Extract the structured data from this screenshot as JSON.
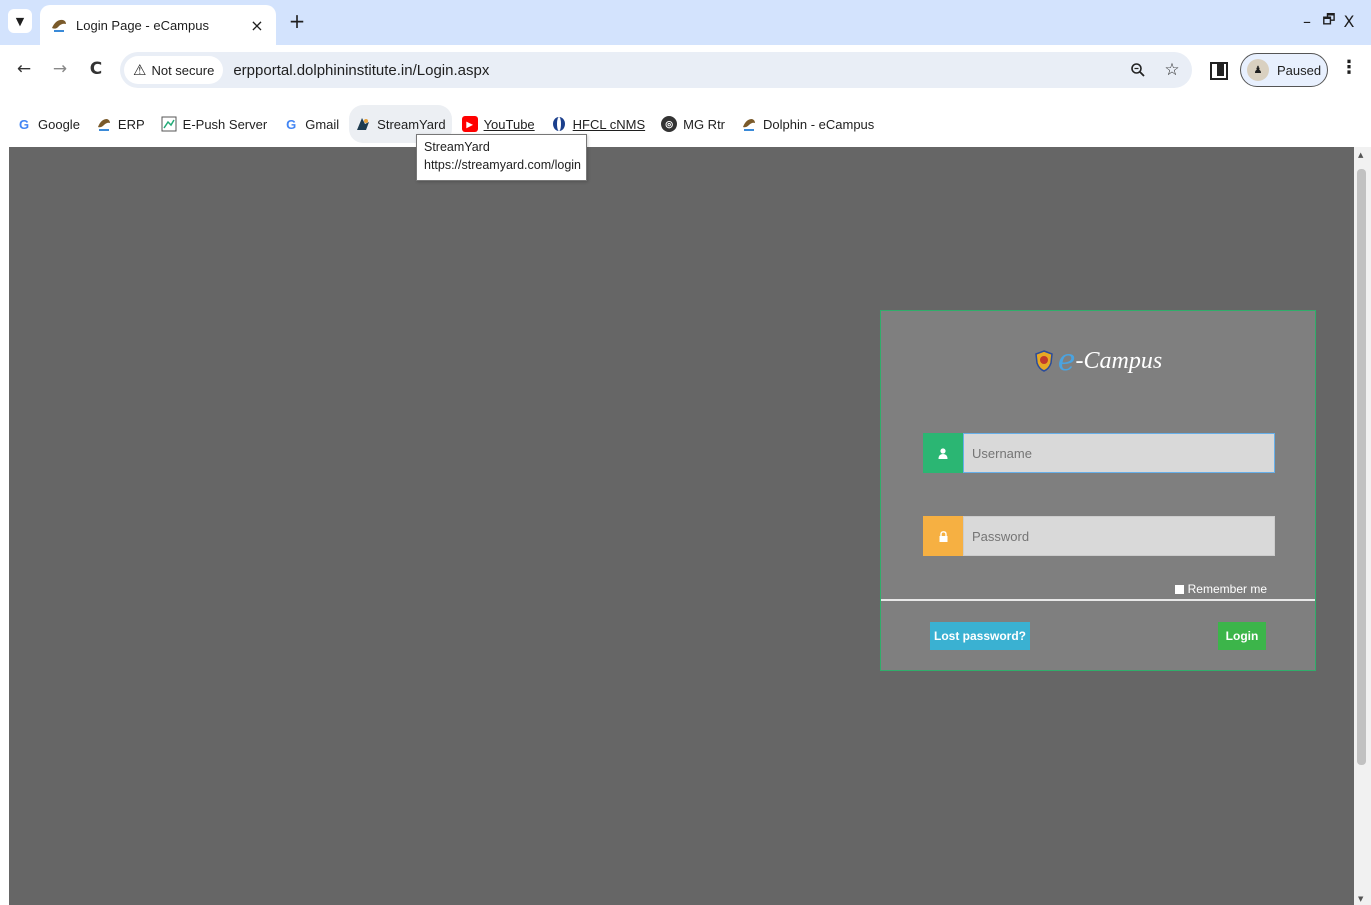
{
  "browser": {
    "tab": {
      "title": "Login Page - eCampus",
      "close": "×"
    },
    "new_tab": "+",
    "window_controls": {
      "minimize": "–",
      "restore": "🗗",
      "close": "X"
    },
    "nav": {
      "back": "←",
      "forward": "→",
      "reload": "C"
    },
    "security_label": "Not secure",
    "url": "erpportal.dolphininstitute.in/Login.aspx",
    "profile": {
      "status": "Paused"
    },
    "bookmarks": [
      {
        "label": "Google",
        "icon": "google-icon"
      },
      {
        "label": "ERP",
        "icon": "erp-icon"
      },
      {
        "label": "E-Push Server",
        "icon": "epush-icon"
      },
      {
        "label": "Gmail",
        "icon": "google-icon"
      },
      {
        "label": "StreamYard",
        "icon": "streamyard-icon"
      },
      {
        "label": "YouTube",
        "icon": "youtube-icon"
      },
      {
        "label": "HFCL cNMS",
        "icon": "hfcl-icon"
      },
      {
        "label": "MG Rtr",
        "icon": "globe-icon"
      },
      {
        "label": "Dolphin - eCampus",
        "icon": "dolphin-icon"
      }
    ],
    "tooltip": {
      "title": "StreamYard",
      "url": "https://streamyard.com/login"
    }
  },
  "login": {
    "brand_e": "e",
    "brand_rest": "-Campus",
    "username_placeholder": "Username",
    "password_placeholder": "Password",
    "remember_label": "Remember me",
    "lost_password_label": "Lost password?",
    "login_label": "Login"
  },
  "colors": {
    "page_bg": "#666666",
    "panel_bg": "#7f7f7f",
    "panel_border": "#2fae6a",
    "user_addon": "#2bb673",
    "pass_addon": "#f6b042",
    "lost_btn": "#3ab1d2",
    "login_btn": "#3cb54a"
  }
}
